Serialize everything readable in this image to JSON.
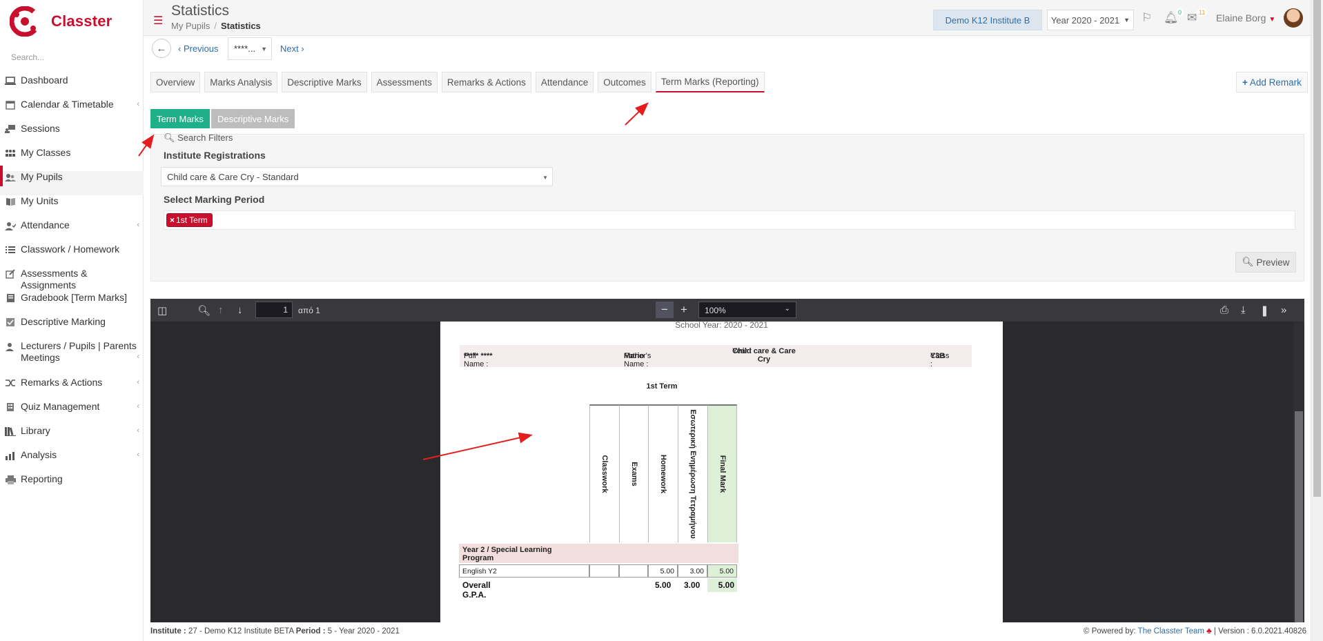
{
  "app": {
    "name": "Classter"
  },
  "sidebar": {
    "search_placeholder": "Search...",
    "items": [
      {
        "label": "Dashboard",
        "icon": "laptop-icon"
      },
      {
        "label": "Calendar & Timetable",
        "icon": "calendar-icon"
      },
      {
        "label": "Sessions",
        "icon": "sessions-icon"
      },
      {
        "label": "My Classes",
        "icon": "classes-icon"
      },
      {
        "label": "My Pupils",
        "icon": "users-icon"
      },
      {
        "label": "My Units",
        "icon": "book-icon"
      },
      {
        "label": "Attendance",
        "icon": "attendance-icon"
      },
      {
        "label": "Classwork / Homework",
        "icon": "list-icon"
      },
      {
        "label": "Assessments & Assignments",
        "icon": "edit-icon"
      },
      {
        "label": "Gradebook [Term Marks]",
        "icon": "gradebook-icon"
      },
      {
        "label": "Descriptive Marking",
        "icon": "check-square-icon"
      },
      {
        "label": "Lecturers / Pupils | Parents Meetings",
        "icon": "meeting-icon"
      },
      {
        "label": "Remarks & Actions",
        "icon": "shuffle-icon"
      },
      {
        "label": "Quiz Management",
        "icon": "quiz-icon"
      },
      {
        "label": "Library",
        "icon": "library-icon"
      },
      {
        "label": "Analysis",
        "icon": "analysis-icon"
      },
      {
        "label": "Reporting",
        "icon": "print-icon"
      }
    ]
  },
  "header": {
    "title": "Statistics",
    "breadcrumb": [
      "My Pupils",
      "Statistics"
    ],
    "institute": "Demo K12 Institute B",
    "year": "Year 2020 - 2021",
    "notifications_count": "0",
    "messages_count": "11",
    "user_name": "Elaine Borg"
  },
  "pager": {
    "previous": "Previous",
    "pupil": "****...",
    "next": "Next"
  },
  "tabs": [
    "Overview",
    "Marks Analysis",
    "Descriptive Marks",
    "Assessments",
    "Remarks & Actions",
    "Attendance",
    "Outcomes",
    "Term Marks (Reporting)"
  ],
  "add_remark": "Add Remark",
  "subtabs": {
    "active": "Term Marks",
    "inactive": "Descriptive Marks"
  },
  "filters": {
    "title": "Search Filters",
    "registrations_label": "Institute Registrations",
    "registrations_value": "Child care & Care Cry - Standard",
    "period_label": "Select Marking Period",
    "period_chip": "1st Term",
    "preview": "Preview"
  },
  "pdf_viewer": {
    "page": "1",
    "of_pages": "από 1",
    "zoom": "100%"
  },
  "report": {
    "school_year": "School Year: 2020 - 2021",
    "full_name_label": "Full Name :",
    "full_name": "***** ****",
    "father_label": "Father's Name :",
    "father": "Mario",
    "year_label": "Year :",
    "year_line1": "Child care & Care",
    "year_line2": "Cry",
    "class_label": "Class :",
    "class": "Y3B",
    "term": "1st Term",
    "columns": [
      "Classwork",
      "Exams",
      "Homework",
      "Εσωτερική Ενημέρωση Τετραμήνου",
      "Final Mark"
    ],
    "group": "Year 2 / Special Learning Program",
    "subject": "English Y2",
    "subject_values": [
      "",
      "",
      "5.00",
      "3.00",
      "5.00"
    ],
    "gpa_label": "Overall G.P.A.",
    "gpa_values": [
      "5.00",
      "3.00",
      "5.00"
    ]
  },
  "footer": {
    "institute_label": "Institute :",
    "institute_value": "27 - Demo K12 Institute BETA",
    "period_label": "Period :",
    "period_value": "5 - Year 2020 - 2021",
    "powered_label": "Powered by:",
    "powered_link": "The Classter Team",
    "version": "| Version : 6.0.2021.40826"
  },
  "colors": {
    "brand": "#c8102e",
    "active_subtab": "#1fb08a",
    "link": "#2f6da8",
    "final_mark_col": "#dff0d8"
  }
}
